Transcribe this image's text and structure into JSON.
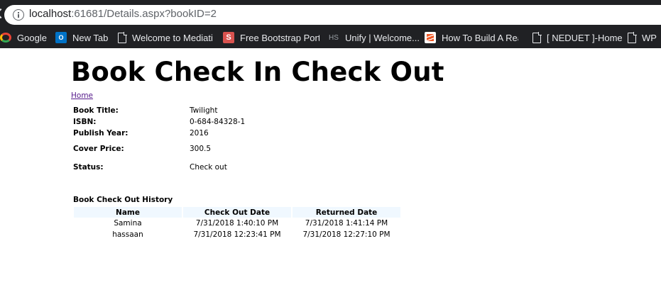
{
  "browser": {
    "url_host": "localhost",
    "url_rest": ":61681/Details.aspx?bookID=2",
    "bookmarks": [
      {
        "label": "Google",
        "icon": "google-icon"
      },
      {
        "label": "New Tab",
        "icon": "outlook-icon"
      },
      {
        "label": "Welcome to Mediati",
        "icon": "page-icon"
      },
      {
        "label": "Free Bootstrap Portf",
        "icon": "s-icon"
      },
      {
        "label": "Unify | Welcome...",
        "icon": "hs-icon"
      },
      {
        "label": "How To Build A Real",
        "icon": "stackoverflow-icon"
      },
      {
        "label": "[ NEDUET ]-Home",
        "icon": "page-icon"
      },
      {
        "label": "WP",
        "icon": "page-icon"
      }
    ]
  },
  "page": {
    "title": "Book Check In Check Out",
    "home_link": "Home"
  },
  "details": {
    "title_label": "Book Title:",
    "title_value": "Twilight",
    "isbn_label": "ISBN:",
    "isbn_value": "0-684-84328-1",
    "year_label": "Publish Year:",
    "year_value": "2016",
    "price_label": "Cover Price:",
    "price_value": "300.5",
    "status_label": "Status:",
    "status_value": "Check out"
  },
  "history": {
    "title": "Book Check Out History",
    "columns": [
      "Name",
      "Check Out Date",
      "Returned Date"
    ],
    "rows": [
      [
        "Samina",
        "7/31/2018 1:40:10 PM",
        "7/31/2018 1:41:14 PM"
      ],
      [
        "hassaan",
        "7/31/2018 12:23:41 PM",
        "7/31/2018 12:27:10 PM"
      ]
    ]
  },
  "colors": {
    "chrome_bg": "#202124",
    "table_header_bg": "#f0f8ff",
    "visited_link": "#551a8b"
  }
}
